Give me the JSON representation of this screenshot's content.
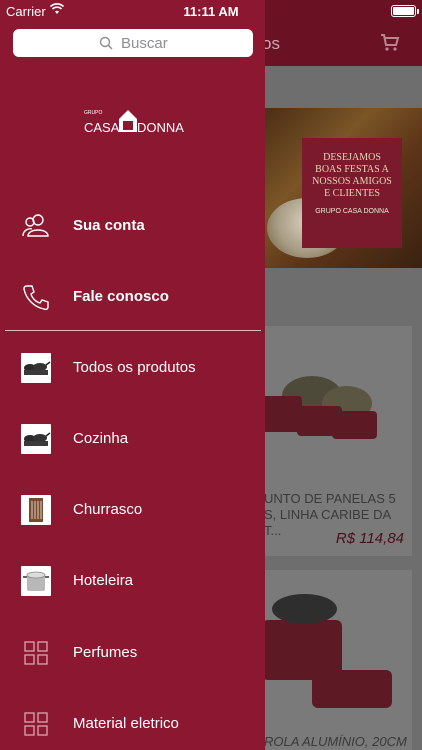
{
  "status_bar": {
    "carrier": "Carrier",
    "time": "11:11 AM"
  },
  "background_app": {
    "nav_title": "os",
    "banner_text": "DESEJAMOS\nBOAS FESTAS A\nNOSSOS AMIGOS\nE CLIENTES",
    "banner_brand": "GRUPO CASA DONNA",
    "product1": {
      "name": "UNTO DE PANELAS 5\nS, LINHA CARIBE DA T...",
      "price": "R$ 114,84"
    },
    "product2": {
      "name": "ROLA ALUMÍNIO, 20CM"
    }
  },
  "drawer": {
    "search": {
      "placeholder": "Buscar"
    },
    "logo": {
      "grupo": "GRUPO",
      "casa": "CASA",
      "donna": "DONNA"
    },
    "account_items": [
      {
        "label": "Sua conta",
        "icon": "users-icon"
      },
      {
        "label": "Fale conosco",
        "icon": "phone-icon"
      }
    ],
    "categories": [
      {
        "label": "Todos os produtos",
        "icon": "pans-thumbnail"
      },
      {
        "label": "Cozinha",
        "icon": "pans-thumbnail"
      },
      {
        "label": "Churrasco",
        "icon": "bbq-thumbnail"
      },
      {
        "label": "Hoteleira",
        "icon": "pot-thumbnail"
      },
      {
        "label": "Perfumes",
        "icon": "grid-icon"
      },
      {
        "label": "Material eletrico",
        "icon": "grid-icon"
      }
    ]
  },
  "colors": {
    "drawer_bg": "#8b1730",
    "nav_bg": "#6a1223",
    "price": "#4a0f1c"
  }
}
